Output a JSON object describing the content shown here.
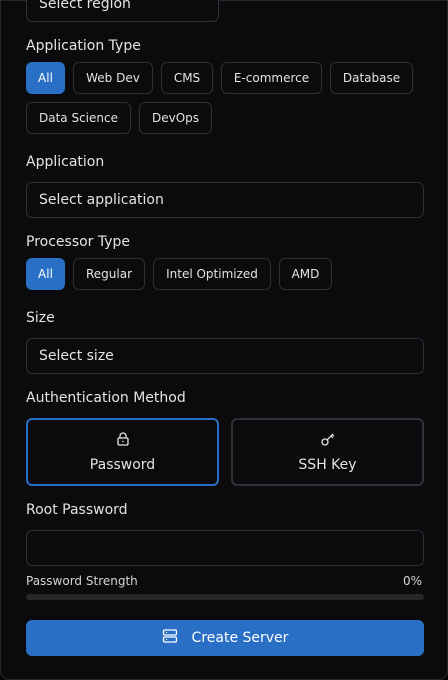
{
  "region": {
    "placeholder": "Select region"
  },
  "application_type": {
    "label": "Application Type",
    "options": [
      "All",
      "Web Dev",
      "CMS",
      "E-commerce",
      "Database",
      "Data Science",
      "DevOps"
    ],
    "selected": "All"
  },
  "application": {
    "label": "Application",
    "placeholder": "Select application"
  },
  "processor_type": {
    "label": "Processor Type",
    "options": [
      "All",
      "Regular",
      "Intel Optimized",
      "AMD"
    ],
    "selected": "All"
  },
  "size": {
    "label": "Size",
    "placeholder": "Select size"
  },
  "auth": {
    "label": "Authentication Method",
    "options": [
      {
        "label": "Password",
        "icon": "lock-icon"
      },
      {
        "label": "SSH Key",
        "icon": "key-icon"
      }
    ],
    "selected": "Password"
  },
  "root_password": {
    "label": "Root Password",
    "value": "",
    "strength_label": "Password Strength",
    "strength_value": "0%",
    "strength_fraction": 0
  },
  "create_button": {
    "label": "Create Server",
    "icon": "server-icon"
  },
  "colors": {
    "accent": "#2a6fc6",
    "background": "#0b0b0d",
    "border": "#2f2f35",
    "text": "#e4e4e7"
  }
}
